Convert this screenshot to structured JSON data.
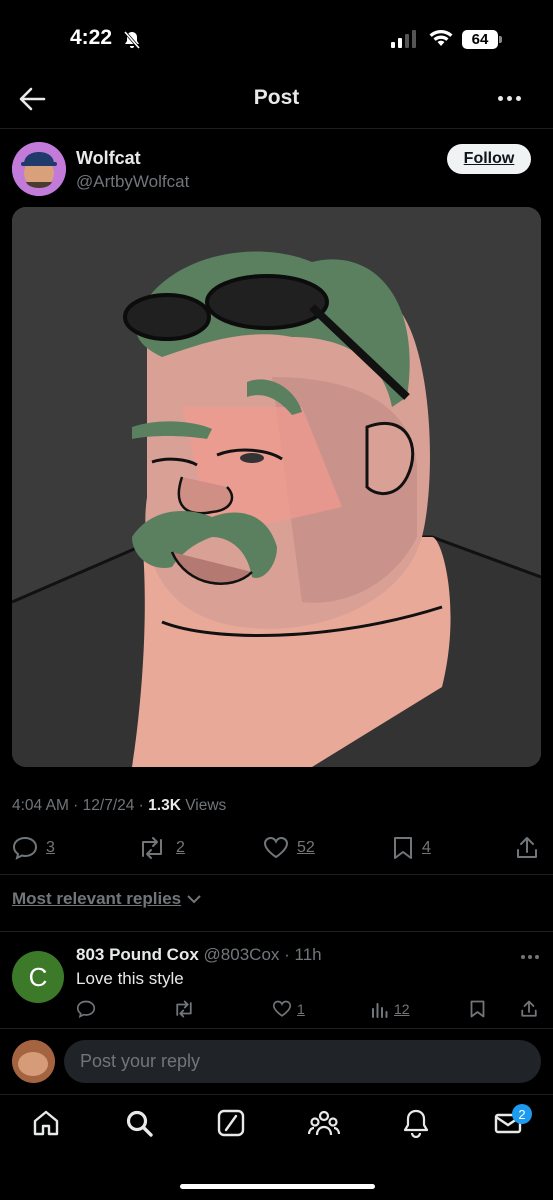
{
  "status": {
    "time": "4:22",
    "battery": "64"
  },
  "header": {
    "title": "Post"
  },
  "author": {
    "name": "Wolfcat",
    "handle": "@ArtbyWolfcat",
    "follow_label": "Follow"
  },
  "post": {
    "time": "4:04 AM",
    "date": "12/7/24",
    "views_count": "1.3K",
    "views_label": "Views",
    "replies": "3",
    "reposts": "2",
    "likes": "52",
    "bookmarks": "4"
  },
  "replies_filter": "Most relevant replies",
  "reply": {
    "avatar_letter": "C",
    "name": "803 Pound Cox",
    "handle": "@803Cox",
    "time": "11h",
    "text": "Love this style",
    "likes": "1",
    "views": "12"
  },
  "compose": {
    "placeholder": "Post your reply"
  },
  "tabbar": {
    "messages_badge": "2"
  },
  "colors": {
    "accent": "#1d9bf0",
    "muted": "#71767b",
    "text": "#e7e9ea",
    "reply_avatar": "#3c7a29"
  }
}
